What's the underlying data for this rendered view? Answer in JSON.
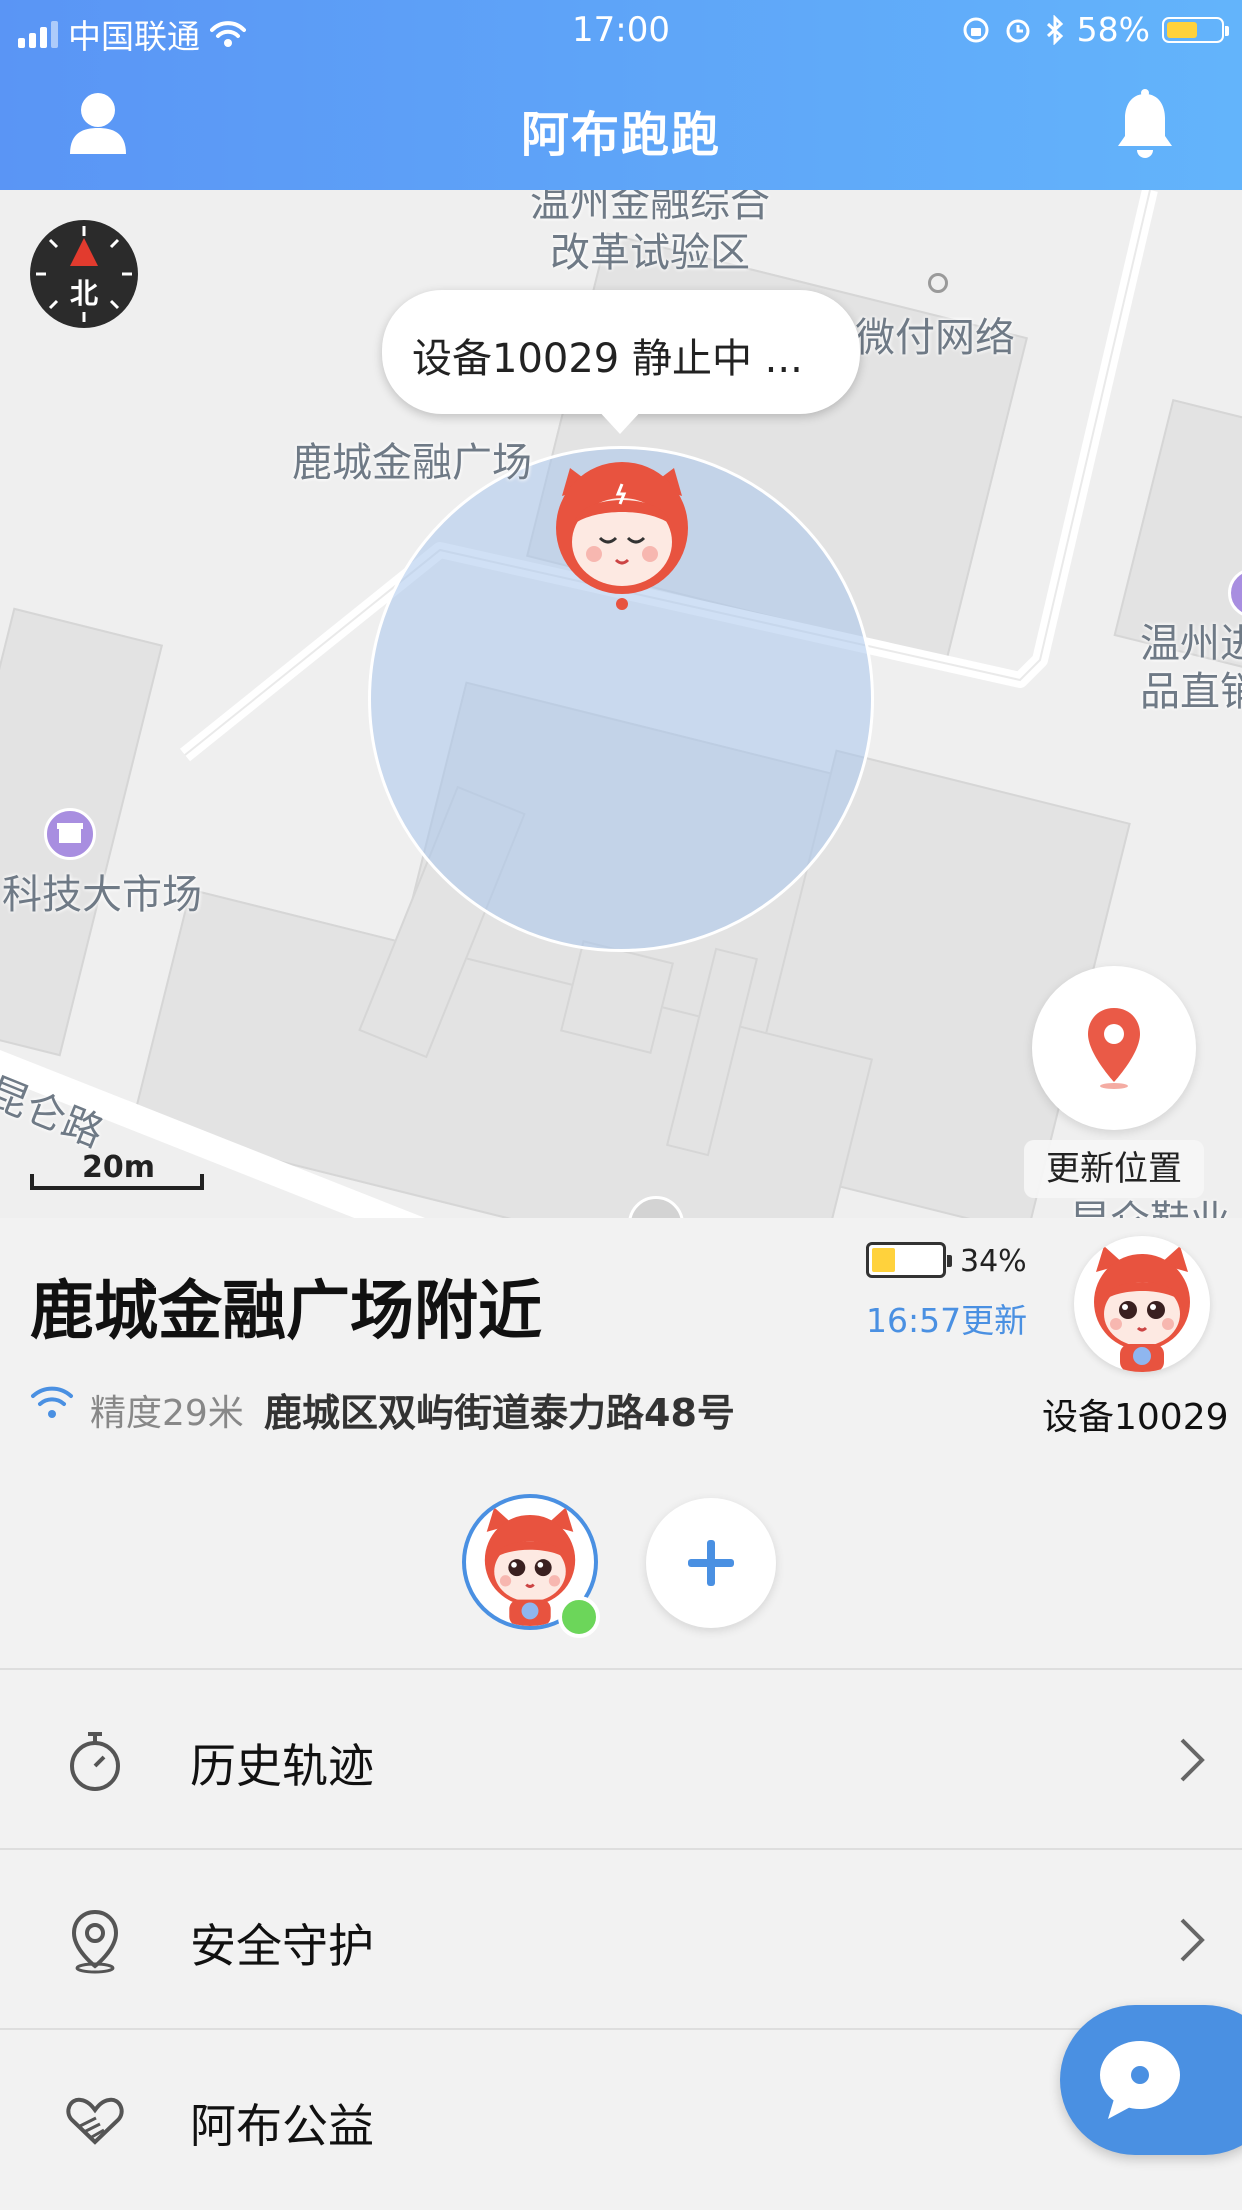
{
  "status_bar": {
    "carrier": "中国联通",
    "time": "17:00",
    "battery_percent": "58%",
    "battery_level": 0.58
  },
  "header": {
    "title": "阿布跑跑"
  },
  "map": {
    "popup": "设备10029 静止中 ...",
    "labels": {
      "top_area": "温州金融综合\n改革试验区",
      "weifu": "微付网络",
      "plaza": "鹿城金融广场",
      "wenzhou_right": "温州进\n品直销",
      "market": "科技大市场",
      "kunlun": "昆仑路",
      "bottom_right": "昆仑鞋业"
    },
    "compass": "北",
    "scale": "20m",
    "update_button": "更新位置"
  },
  "info": {
    "location_title": "鹿城金融广场附近",
    "battery_percent": "34%",
    "battery_level": 0.34,
    "updated": "16:57更新",
    "accuracy": "精度29米",
    "address": "鹿城区双屿街道泰力路48号",
    "device_name": "设备10029"
  },
  "menu": [
    {
      "label": "历史轨迹",
      "icon": "stopwatch-icon"
    },
    {
      "label": "安全守护",
      "icon": "location-pin-icon"
    },
    {
      "label": "阿布公益",
      "icon": "heart-hand-icon"
    }
  ],
  "colors": {
    "header_start": "#5a95f5",
    "header_end": "#63b4fb",
    "accent": "#4a90e2",
    "online": "#6cd65a",
    "pin": "#ea5a47"
  }
}
